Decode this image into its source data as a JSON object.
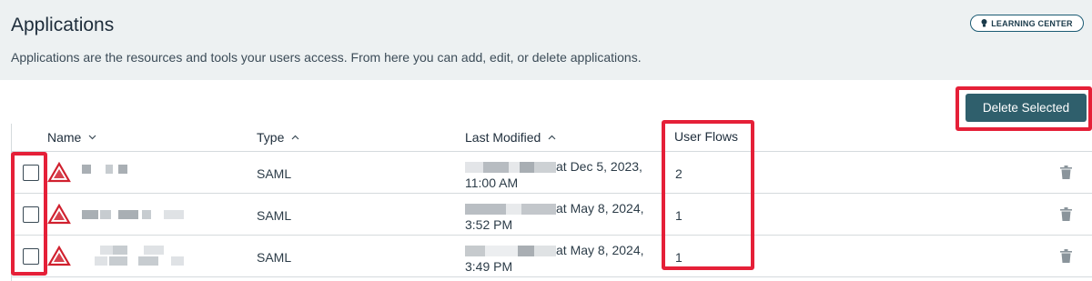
{
  "page": {
    "title": "Applications",
    "description": "Applications are the resources and tools your users access. From here you can add, edit, or delete applications.",
    "learning_center": "LEARNING CENTER"
  },
  "toolbar": {
    "delete_label": "Delete Selected"
  },
  "table": {
    "columns": [
      {
        "label": "Name",
        "sort": "chevron-down-icon"
      },
      {
        "label": "Type",
        "sort": "chevron-up-icon"
      },
      {
        "label": "Last Modified",
        "sort": "chevron-up-icon"
      },
      {
        "label": "User Flows"
      }
    ],
    "rows": [
      {
        "type": "SAML",
        "modified_tail": "at Dec 5, 2023,",
        "modified_time": "11:00 AM",
        "user_flows": "2"
      },
      {
        "type": "SAML",
        "modified_tail": "at May 8, 2024,",
        "modified_time": "3:52 PM",
        "user_flows": "1"
      },
      {
        "type": "SAML",
        "modified_tail": "at May 8, 2024,",
        "modified_time": "3:49 PM",
        "user_flows": "1"
      }
    ]
  },
  "colors": {
    "header_bg": "#edf1f2",
    "primary_button": "#2f5f6c",
    "highlight": "#e52038",
    "logo_red": "#d0202e"
  }
}
